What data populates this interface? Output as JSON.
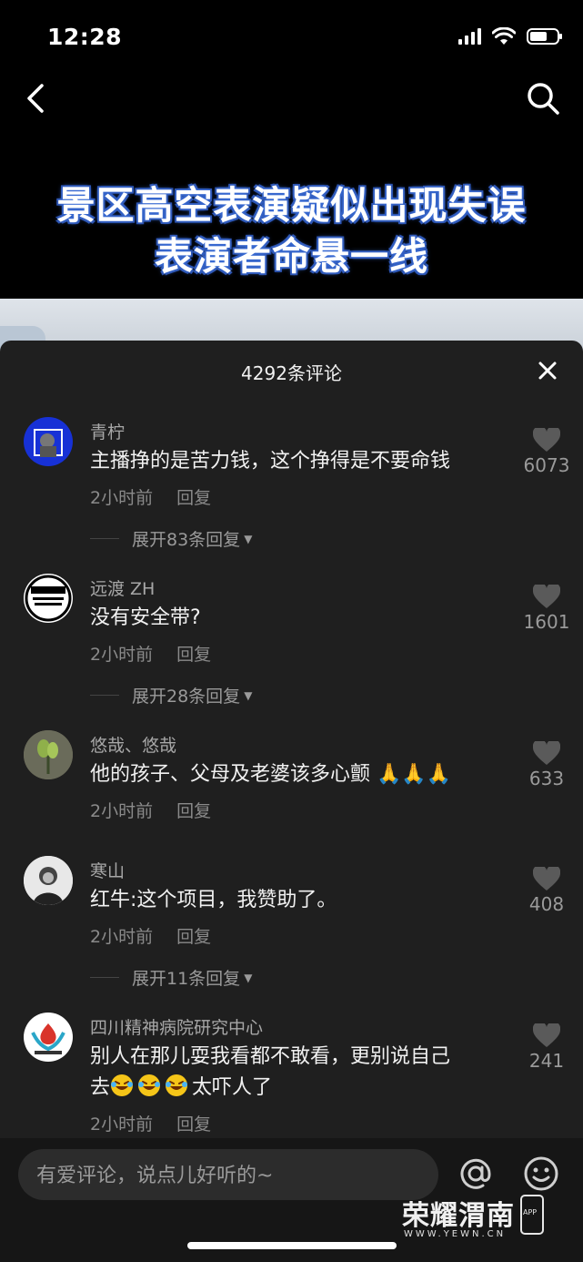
{
  "status_bar": {
    "time": "12:28"
  },
  "video": {
    "title_line1": "景区高空表演疑似出现失误",
    "title_line2": "表演者命悬一线"
  },
  "comments_sheet": {
    "title": "4292条评论",
    "comments": [
      {
        "name": "青柠",
        "text": "主播挣的是苦力钱，这个挣得是不要命钱",
        "time": "2小时前",
        "reply": "回复",
        "likes": "6073",
        "expand": "展开83条回复"
      },
      {
        "name": "远渡 ZH",
        "text": "没有安全带?",
        "time": "2小时前",
        "reply": "回复",
        "likes": "1601",
        "expand": "展开28条回复"
      },
      {
        "name": "悠哉、悠哉",
        "text": "他的孩子、父母及老婆该多心颤",
        "time": "2小时前",
        "reply": "回复",
        "likes": "633"
      },
      {
        "name": "寒山",
        "text": "红牛:这个项目，我赞助了。",
        "time": "2小时前",
        "reply": "回复",
        "likes": "408",
        "expand": "展开11条回复"
      },
      {
        "name": "四川精神病院研究中心",
        "text_line1": "别人在那儿耍我看都不敢看，更别说自己",
        "text_line2_prefix": "去",
        "text_line2_suffix": "太吓人了",
        "time": "2小时前",
        "reply": "回复",
        "likes": "241"
      }
    ]
  },
  "bottom_bar": {
    "input_placeholder": "有爱评论，说点儿好听的~",
    "watermark": "荣耀渭南",
    "watermark_sub": "WWW.YEWN.CN",
    "watermark_app": "APP"
  },
  "colors": {
    "sheet_bg": "#1f1f1f",
    "title_glow": "#3c6fd8"
  }
}
